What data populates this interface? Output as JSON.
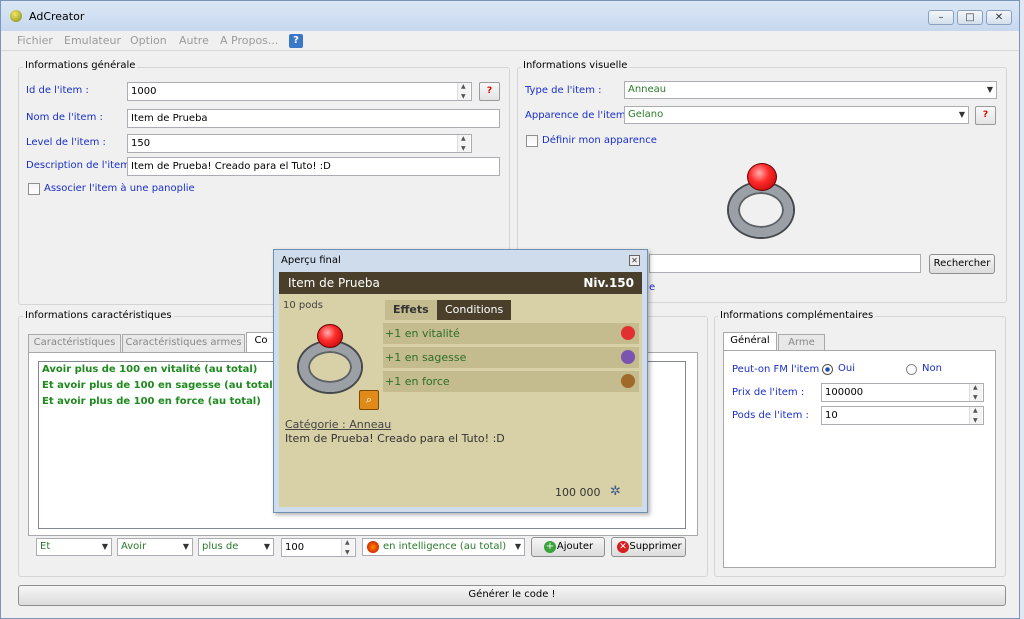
{
  "window": {
    "title": "AdCreator",
    "min": "–",
    "max": "□",
    "close": "✕"
  },
  "menu": [
    "Fichier",
    "Emulateur",
    "Option",
    "Autre",
    "A Propos...",
    "?"
  ],
  "general": {
    "title": "Informations générale",
    "id_label": "Id de l'item :",
    "id_value": "1000",
    "name_label": "Nom de l'item :",
    "name_value": "Item de Prueba",
    "level_label": "Level de l'item :",
    "level_value": "150",
    "desc_label": "Description de l'item :",
    "desc_value": "Item de Prueba! Creado para el Tuto! :D",
    "panoplie_label": "Associer l'item à une panoplie",
    "help": "?"
  },
  "visual": {
    "title": "Informations visuelle",
    "type_label": "Type de l'item :",
    "type_value": "Anneau",
    "apparence_label": "Apparence de l'item :",
    "apparence_value": "Gelano",
    "define_label": "Définir mon apparence",
    "search_button": "Rechercher",
    "help": "?"
  },
  "characteristics": {
    "title": "Informations caractéristiques",
    "tabs": [
      "Caractéristiques",
      "Caractéristiques armes",
      "Co"
    ],
    "conditions": [
      "Avoir plus de 100 en vitalité (au total)",
      "Et avoir plus de 100 en sagesse (au total)",
      "Et avoir plus de 100 en force (au total)"
    ],
    "combo_et": "Et",
    "combo_avoir": "Avoir",
    "combo_plusde": "plus de",
    "amount": "100",
    "stat": "en intelligence (au total)",
    "add_button": "Ajouter",
    "delete_button": "Supprimer"
  },
  "complementary": {
    "title": "Informations complémentaires",
    "tabs": [
      "Général",
      "Arme"
    ],
    "fm_label": "Peut-on FM l'item :",
    "oui": "Oui",
    "non": "Non",
    "price_label": "Prix de l'item :",
    "price_value": "100000",
    "pods_label": "Pods de l'item :",
    "pods_value": "10"
  },
  "generate_button": "Générer le code !",
  "preview": {
    "title": "Aperçu final",
    "item_name": "Item de Prueba",
    "level": "Niv.150",
    "pods": "10 pods",
    "tabs": [
      "Effets",
      "Conditions"
    ],
    "effects": [
      "+1 en vitalité",
      "+1 en sagesse",
      "+1 en force"
    ],
    "category": "Catégorie : Anneau",
    "description": "Item de Prueba! Creado para el Tuto! :D",
    "price": "100 000",
    "fragment_e": "e"
  },
  "colors": {
    "label_blue": "#1a2fc9",
    "condition_green": "#1e8a1e",
    "preview_bg": "#d8d0a6"
  }
}
